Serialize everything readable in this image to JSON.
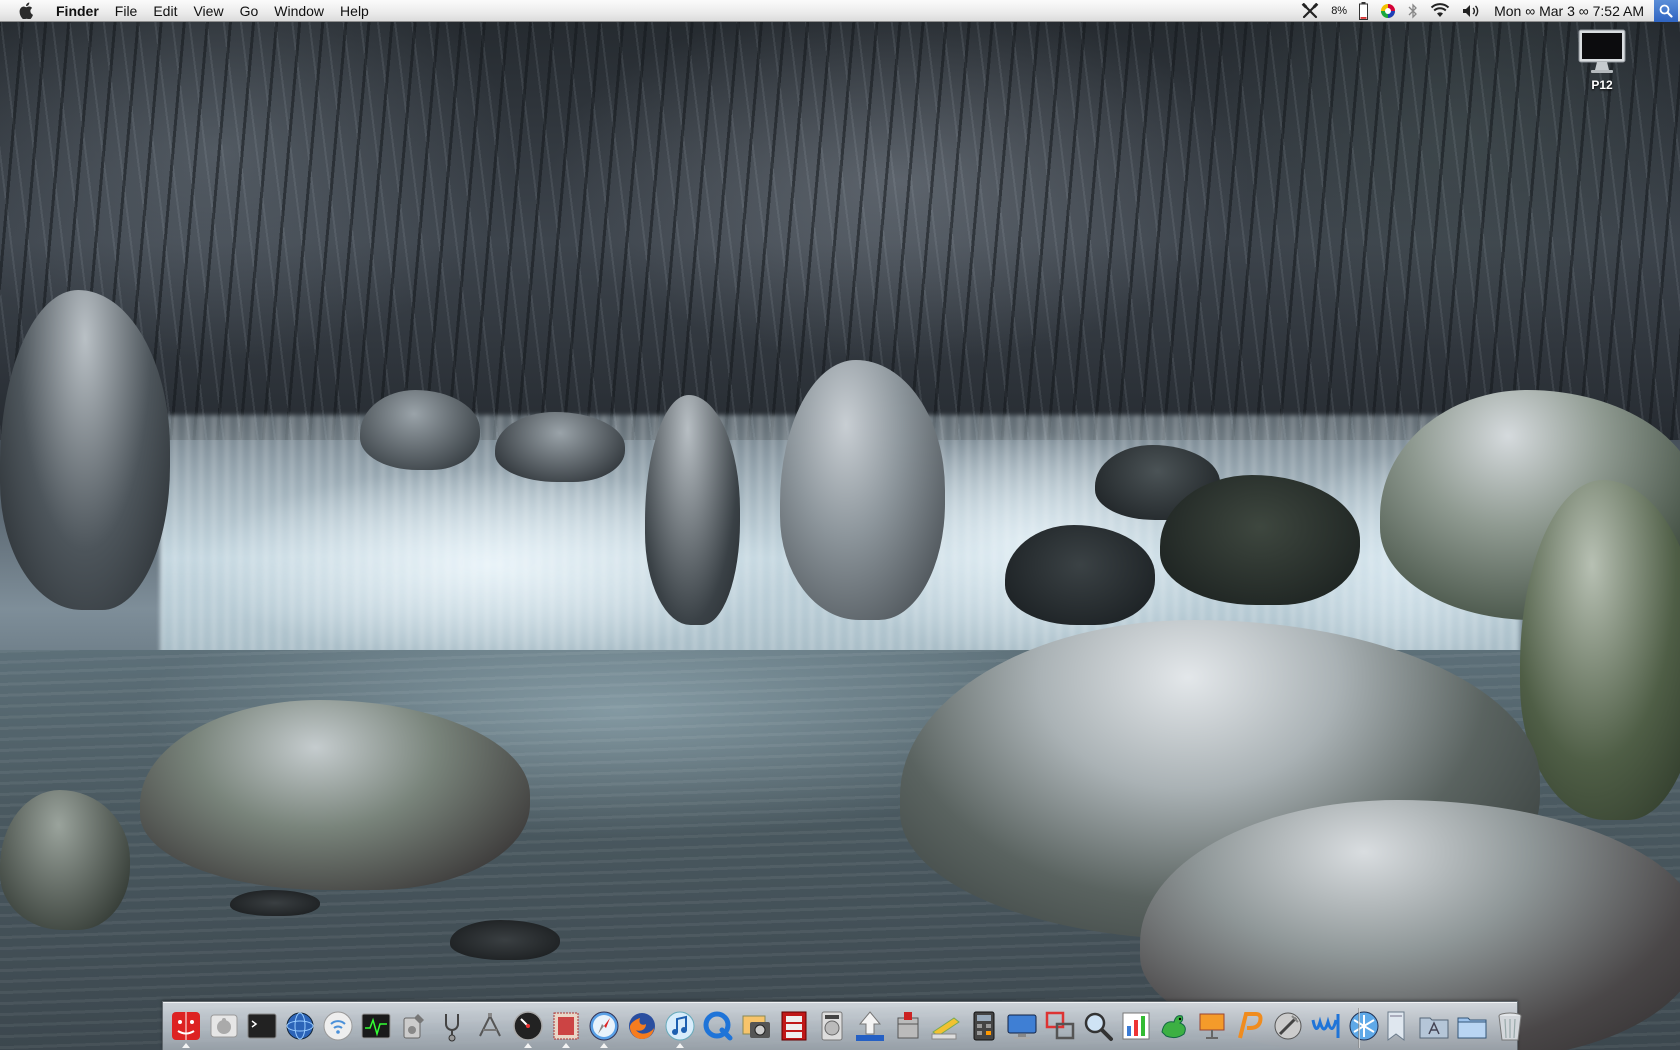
{
  "menubar": {
    "app_name": "Finder",
    "menus": [
      "File",
      "Edit",
      "View",
      "Go",
      "Window",
      "Help"
    ],
    "battery_percent": "8%",
    "clock": "Mon ∞ Mar 3 ∞ 7:52 AM"
  },
  "desktop": {
    "volume_label": "P12"
  },
  "dock": {
    "apps": [
      {
        "id": "finder",
        "running": true
      },
      {
        "id": "system-preferences",
        "running": false
      },
      {
        "id": "terminal",
        "running": false
      },
      {
        "id": "network-utility",
        "running": false
      },
      {
        "id": "airport-utility",
        "running": false
      },
      {
        "id": "activity-monitor",
        "running": false
      },
      {
        "id": "disk-utility",
        "running": false
      },
      {
        "id": "keychain",
        "running": false
      },
      {
        "id": "instruments",
        "running": false
      },
      {
        "id": "dashboard",
        "running": true
      },
      {
        "id": "stamps-app",
        "running": true
      },
      {
        "id": "safari",
        "running": true
      },
      {
        "id": "firefox",
        "running": false
      },
      {
        "id": "itunes",
        "running": true
      },
      {
        "id": "quicktime",
        "running": false
      },
      {
        "id": "iphoto",
        "running": false
      },
      {
        "id": "photo-booth",
        "running": false
      },
      {
        "id": "dvd-player",
        "running": false
      },
      {
        "id": "flickr-uploadr",
        "running": false
      },
      {
        "id": "stuffit",
        "running": false
      },
      {
        "id": "preview",
        "running": false
      },
      {
        "id": "calculator",
        "running": false
      },
      {
        "id": "remote-desktop",
        "running": false
      },
      {
        "id": "vnc",
        "running": false
      },
      {
        "id": "inspector",
        "running": false
      },
      {
        "id": "grapher",
        "running": false
      },
      {
        "id": "cyberduck",
        "running": false
      },
      {
        "id": "presenter",
        "running": false
      },
      {
        "id": "parallels",
        "running": false
      },
      {
        "id": "script-editor",
        "running": false
      },
      {
        "id": "wireless-diagnostics",
        "running": false
      },
      {
        "id": "snowflake-app",
        "running": false
      }
    ],
    "docs": [
      {
        "id": "documents-stack"
      },
      {
        "id": "applications-folder"
      },
      {
        "id": "downloads-folder"
      },
      {
        "id": "trash"
      }
    ]
  }
}
